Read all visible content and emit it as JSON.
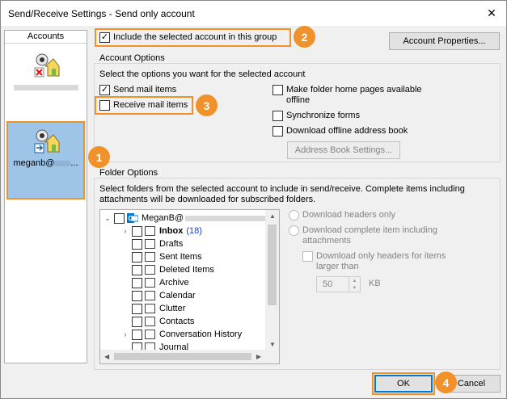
{
  "window": {
    "title": "Send/Receive Settings - Send only account"
  },
  "accounts": {
    "header": "Accounts",
    "items": [
      {
        "name": "",
        "selected": false
      },
      {
        "name": "meganb@",
        "suffix": "...",
        "selected": true
      }
    ]
  },
  "include_group": {
    "label": "Include the selected account in this group",
    "checked": true
  },
  "account_properties_button": "Account Properties...",
  "account_options": {
    "title": "Account Options",
    "description": "Select the options you want for the selected account",
    "send_mail": {
      "label": "Send mail items",
      "checked": true
    },
    "receive_mail": {
      "label": "Receive mail items",
      "checked": false
    },
    "make_folder_home": {
      "label": "Make folder home pages available offline",
      "checked": false
    },
    "sync_forms": {
      "label": "Synchronize forms",
      "checked": false
    },
    "download_oab": {
      "label": "Download offline address book",
      "checked": false
    },
    "address_book_settings": "Address Book Settings..."
  },
  "folder_options": {
    "title": "Folder Options",
    "description": "Select folders from the selected account to include in send/receive. Complete items including attachments will be downloaded for subscribed folders.",
    "root": "MeganB@",
    "folders": [
      {
        "name": "Inbox",
        "count": "(18)",
        "bold": true,
        "expandable": true,
        "icon": "inbox-icon"
      },
      {
        "name": "Drafts",
        "count": "",
        "bold": false,
        "expandable": false,
        "icon": "drafts-icon"
      },
      {
        "name": "Sent Items",
        "count": "",
        "bold": false,
        "expandable": false,
        "icon": "folder-icon"
      },
      {
        "name": "Deleted Items",
        "count": "",
        "bold": false,
        "expandable": false,
        "icon": "trash-icon"
      },
      {
        "name": "Archive",
        "count": "",
        "bold": false,
        "expandable": false,
        "icon": "folder-icon"
      },
      {
        "name": "Calendar",
        "count": "",
        "bold": false,
        "expandable": false,
        "icon": "calendar-icon"
      },
      {
        "name": "Clutter",
        "count": "",
        "bold": false,
        "expandable": false,
        "icon": "folder-icon"
      },
      {
        "name": "Contacts",
        "count": "",
        "bold": false,
        "expandable": false,
        "icon": "contacts-icon"
      },
      {
        "name": "Conversation History",
        "count": "",
        "bold": false,
        "expandable": true,
        "icon": "folder-icon"
      },
      {
        "name": "Journal",
        "count": "",
        "bold": false,
        "expandable": false,
        "icon": "journal-icon"
      }
    ],
    "download_headers_only": "Download headers only",
    "download_complete": "Download complete item including attachments",
    "download_headers_larger": "Download only headers for items larger than",
    "size_value": "50",
    "size_unit": "KB"
  },
  "buttons": {
    "ok": "OK",
    "cancel": "Cancel"
  },
  "callouts": [
    "1",
    "2",
    "3",
    "4"
  ],
  "colors": {
    "highlight": "#f0912a",
    "selection": "#9ec5e8",
    "outlook_blue": "#0078d4"
  }
}
